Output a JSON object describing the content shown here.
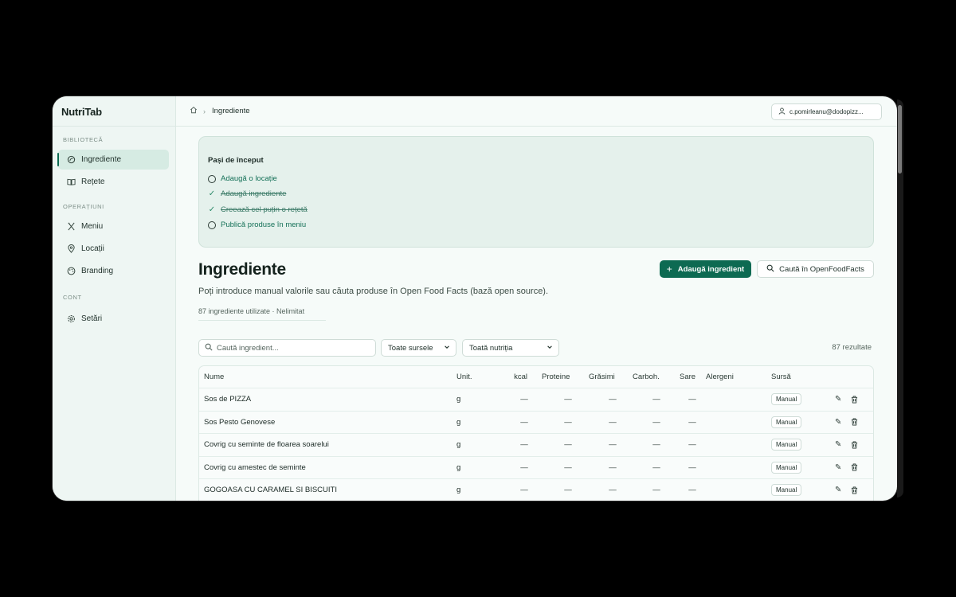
{
  "app": {
    "brand": "NutriTab"
  },
  "sidebar": {
    "sections": [
      {
        "title": "BIBLIOTECĂ",
        "items": [
          {
            "label": "Ingrediente",
            "icon": "ingredients-icon",
            "active": true
          },
          {
            "label": "Rețete",
            "icon": "book-icon"
          }
        ]
      },
      {
        "title": "OPERAȚIUNI",
        "items": [
          {
            "label": "Meniu",
            "icon": "utensils-icon"
          },
          {
            "label": "Locații",
            "icon": "location-pin-icon"
          },
          {
            "label": "Branding",
            "icon": "palette-icon"
          }
        ]
      },
      {
        "title": "CONT",
        "items": [
          {
            "label": "Setări",
            "icon": "gear-icon"
          }
        ]
      }
    ]
  },
  "header": {
    "breadcrumb_current": "Ingrediente",
    "user_email": "c.pomirleanu@dodopizz..."
  },
  "onboarding": {
    "title": "Pași de început",
    "steps": [
      {
        "label": "Adaugă o locație",
        "done": false
      },
      {
        "label": "Adaugă ingrediente",
        "done": true
      },
      {
        "label": "Creează cel puțin o rețetă",
        "done": true
      },
      {
        "label": "Publică produse în meniu",
        "done": false
      }
    ]
  },
  "page": {
    "title": "Ingrediente",
    "subtitle": "Poți introduce manual valorile sau căuta produse în Open Food Facts (bază open source).",
    "usage": "87 ingrediente utilizate · Nelimitat",
    "add_button": "Adaugă ingredient",
    "search_off_button": "Caută în OpenFoodFacts"
  },
  "filters": {
    "search_placeholder": "Caută ingredient...",
    "source_select": "Toate sursele",
    "nutrition_select": "Toată nutriția",
    "results": "87 rezultate"
  },
  "table": {
    "columns": [
      "Nume",
      "Unit.",
      "kcal",
      "Proteine",
      "Grăsimi",
      "Carboh.",
      "Sare",
      "Alergeni",
      "Sursă"
    ],
    "rows": [
      {
        "name": "Sos de PIZZA",
        "unit": "g",
        "kcal": "—",
        "protein": "—",
        "fat": "—",
        "carbs": "—",
        "salt": "—",
        "allergens": "",
        "source": "Manual"
      },
      {
        "name": "Sos Pesto Genovese",
        "unit": "g",
        "kcal": "—",
        "protein": "—",
        "fat": "—",
        "carbs": "—",
        "salt": "—",
        "allergens": "",
        "source": "Manual"
      },
      {
        "name": "Covrig cu seminte de floarea soarelui",
        "unit": "g",
        "kcal": "—",
        "protein": "—",
        "fat": "—",
        "carbs": "—",
        "salt": "—",
        "allergens": "",
        "source": "Manual"
      },
      {
        "name": "Covrig cu amestec de seminte",
        "unit": "g",
        "kcal": "—",
        "protein": "—",
        "fat": "—",
        "carbs": "—",
        "salt": "—",
        "allergens": "",
        "source": "Manual"
      },
      {
        "name": "GOGOASA CU CARAMEL SI BISCUITI",
        "unit": "g",
        "kcal": "—",
        "protein": "—",
        "fat": "—",
        "carbs": "—",
        "salt": "—",
        "allergens": "",
        "source": "Manual"
      }
    ]
  },
  "colors": {
    "accent": "#0d6a52",
    "background": "#f6fbf9",
    "sidebar": "#eef6f3",
    "panel": "#e5f1ec"
  }
}
